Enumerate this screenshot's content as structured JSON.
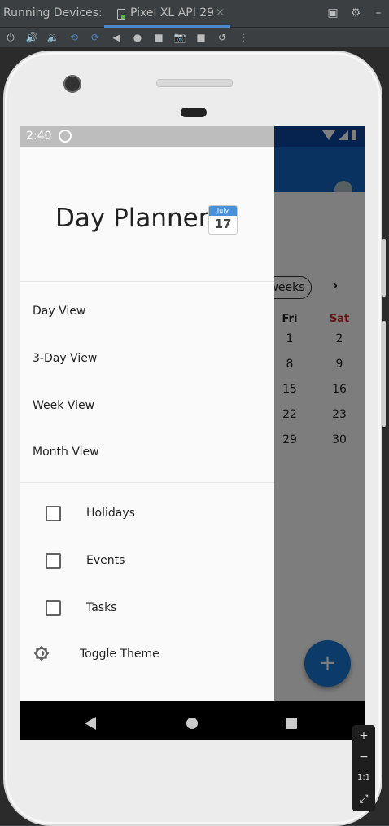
{
  "ide": {
    "title": "Running Devices:",
    "tab_name": "Pixel XL API 29",
    "tab_close": "×",
    "right_icons": [
      "window-icon",
      "gear-icon",
      "minimize-icon"
    ],
    "toolbar_icons": [
      "power-icon",
      "volume-up-icon",
      "volume-down-icon",
      "rotate-left-icon",
      "rotate-right-icon",
      "back-icon",
      "home-icon",
      "overview-icon",
      "camera-icon",
      "record-icon",
      "restore-icon",
      "more-icon"
    ]
  },
  "status": {
    "time": "2:40"
  },
  "drawer": {
    "title": "Day Planner",
    "emoji": {
      "month": "July",
      "day": "17"
    },
    "menu": [
      "Day View",
      "3-Day View",
      "Week View",
      "Month View"
    ],
    "checkboxes": [
      "Holidays",
      "Events",
      "Tasks"
    ],
    "toggle_theme": "Toggle Theme"
  },
  "background": {
    "weeks_chip": "weeks",
    "chevron": "›",
    "headers": [
      "Fri",
      "Sat"
    ],
    "fri": [
      "1",
      "8",
      "15",
      "22",
      "29"
    ],
    "sat": [
      "2",
      "9",
      "16",
      "23",
      "30"
    ],
    "fab": "+"
  },
  "zoom": {
    "plus": "+",
    "minus": "−",
    "ratio": "1:1",
    "fit": "⤢"
  },
  "colors": {
    "app_bar": "#1565c0",
    "fab": "#1976d2",
    "sat_header": "#c62828"
  }
}
